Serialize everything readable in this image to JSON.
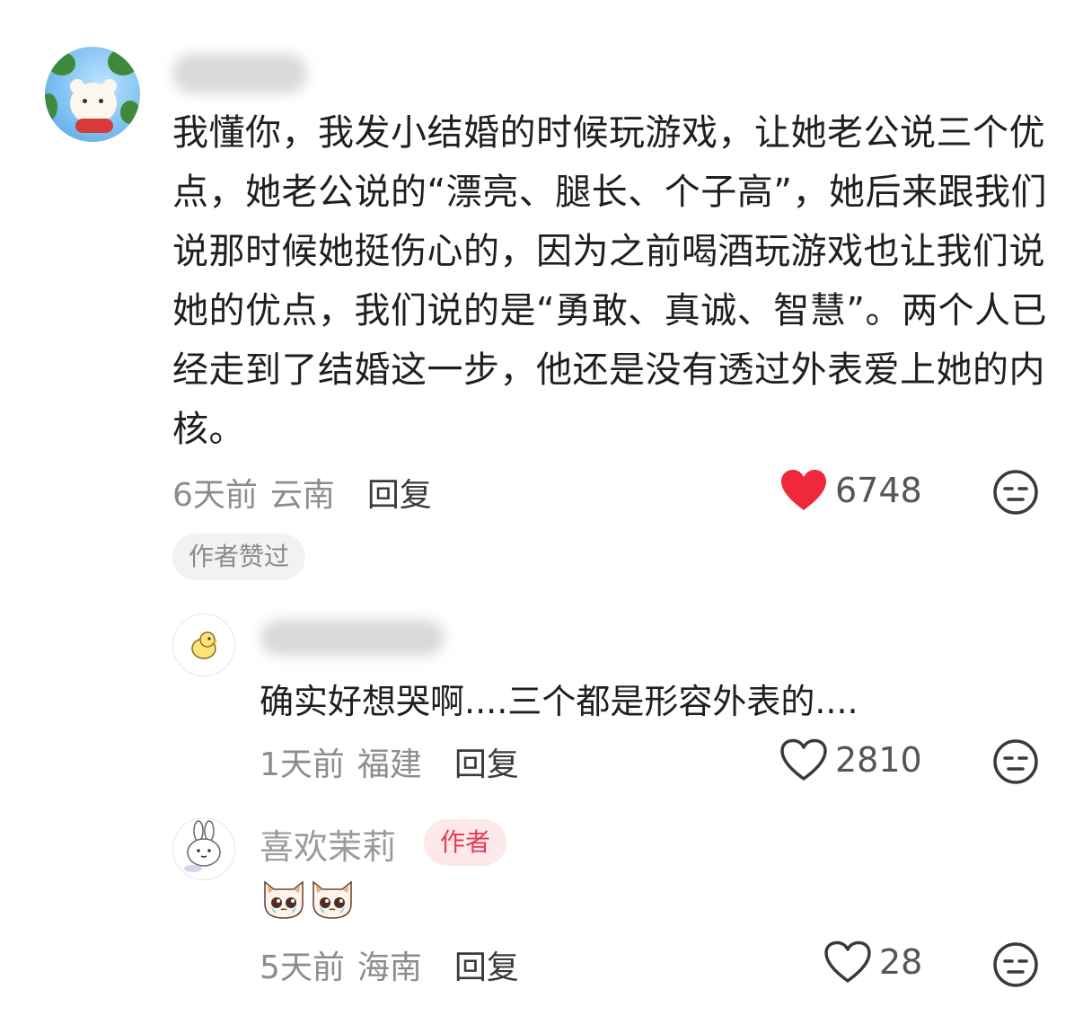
{
  "main_comment": {
    "text": "我懂你，我发小结婚的时候玩游戏，让她老公说三个优点，她老公说的“漂亮、腿长、个子高”，她后来跟我们说那时候她挺伤心的，因为之前喝酒玩游戏也让我们说她的优点，我们说的是“勇敢、真诚、智慧”。两个人已经走到了结婚这一步，他还是没有透过外表爱上她的内核。",
    "time": "6天前",
    "region": "云南",
    "reply_label": "回复",
    "likes": "6748",
    "liked": true,
    "author_liked_badge": "作者赞过"
  },
  "reply_1": {
    "text": "确实好想哭啊....三个都是形容外表的....",
    "time": "1天前",
    "region": "福建",
    "reply_label": "回复",
    "likes": "2810",
    "liked": false
  },
  "reply_2": {
    "author_name": "喜欢茉莉",
    "author_badge": "作者",
    "emojis": [
      "crying-cat-emoji",
      "crying-cat-emoji"
    ],
    "time": "5天前",
    "region": "海南",
    "reply_label": "回复",
    "likes": "28",
    "liked": false
  },
  "colors": {
    "like_active": "#f0283c",
    "author_badge_bg": "#fde8ea",
    "author_badge_text": "#e83a55",
    "meta_text": "#8d8d8d"
  }
}
